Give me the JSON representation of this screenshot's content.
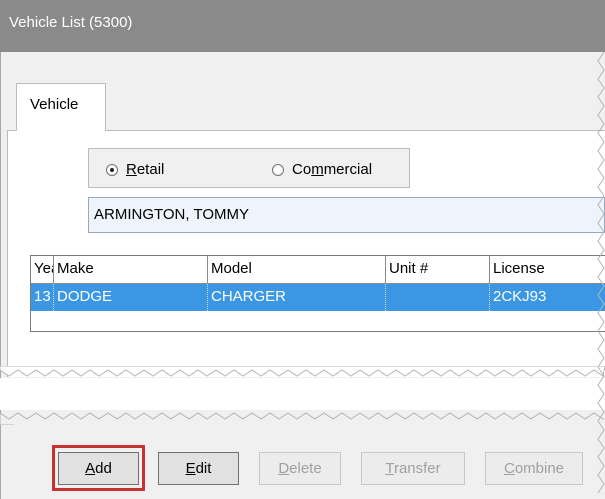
{
  "window": {
    "title": "Vehicle List (5300)"
  },
  "tabs": [
    {
      "label": "Vehicle"
    }
  ],
  "customer_type": {
    "options": [
      {
        "label": "Retail",
        "selected": true
      },
      {
        "label": "Commercial",
        "selected": false
      }
    ]
  },
  "customer_name": "ARMINGTON, TOMMY",
  "vehicle_table": {
    "columns": [
      "Year",
      "Make",
      "Model",
      "Unit #",
      "License"
    ],
    "rows": [
      [
        "13",
        "DODGE",
        "CHARGER",
        "",
        "2CKJ93"
      ]
    ]
  },
  "buttons": {
    "add": "Add",
    "edit": "Edit",
    "delete": "Delete",
    "transfer": "Transfer",
    "combine": "Combine"
  },
  "colors": {
    "selection": "#3b97e3",
    "highlight_border": "#c83232",
    "titlebar": "#8a8a8a"
  }
}
